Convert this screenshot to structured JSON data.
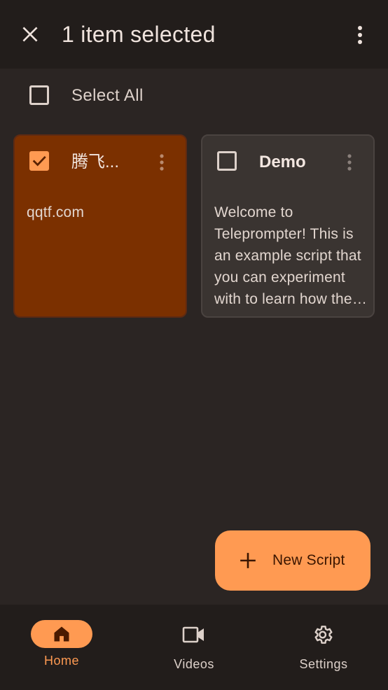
{
  "header": {
    "title": "1 item selected",
    "close_icon": "close-icon",
    "more_icon": "more-vert-icon"
  },
  "select_all": {
    "label": "Select All",
    "checked": false
  },
  "scripts": [
    {
      "title": "腾飞...",
      "preview": "qqtf.com",
      "selected": true
    },
    {
      "title": "Demo",
      "preview": "Welcome to Teleprompter! This is an example script that you can experiment with to learn how the app works.",
      "selected": false
    }
  ],
  "fab": {
    "label": "New Script",
    "icon": "plus-icon"
  },
  "nav": {
    "home_label": "Home",
    "videos_label": "Videos",
    "settings_label": "Settings",
    "active": "Home"
  },
  "colors": {
    "accent": "#ff9a52",
    "background": "#2b2523",
    "bar": "#221d1b",
    "selected_card": "#7b3000",
    "card": "#3a3431"
  }
}
